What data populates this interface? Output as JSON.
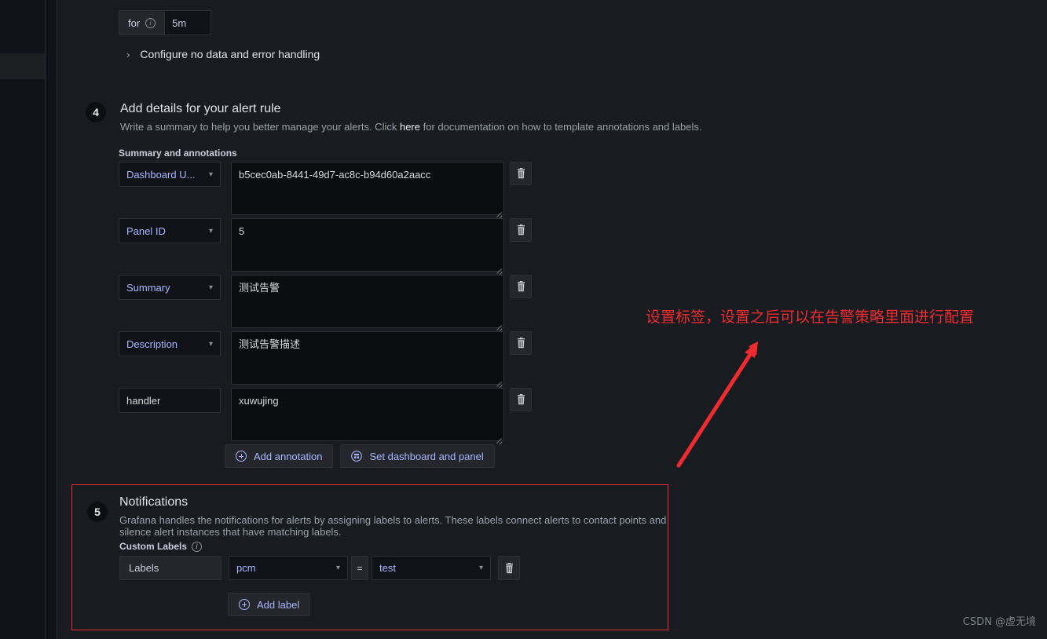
{
  "colors": {
    "accent_link": "#a7b6ff",
    "annotation_red": "#ee2b30",
    "panel_bg": "#181b1f",
    "input_bg": "#0b0c0e",
    "border": "#2e3036"
  },
  "condition": {
    "for_label": "for",
    "for_info_icon": "info-circle-icon",
    "for_value": "5m",
    "collapse_icon": "chevron-right-icon",
    "collapse_label": "Configure no data and error handling"
  },
  "step4": {
    "number": "4",
    "title": "Add details for your alert rule",
    "desc_before": "Write a summary to help you better manage your alerts. Click ",
    "desc_link": "here",
    "desc_after": " for documentation on how to template annotations and labels.",
    "section_label": "Summary and annotations",
    "annotations": [
      {
        "key": "Dashboard U...",
        "key_type": "select",
        "value": "b5cec0ab-8441-49d7-ac8c-b94d60a2aacc",
        "delete_icon": "trash-icon"
      },
      {
        "key": "Panel ID",
        "key_type": "select",
        "value": "5",
        "delete_icon": "trash-icon"
      },
      {
        "key": "Summary",
        "key_type": "select",
        "value": "测试告警",
        "delete_icon": "trash-icon"
      },
      {
        "key": "Description",
        "key_type": "select",
        "value": "测试告警描述",
        "delete_icon": "trash-icon"
      },
      {
        "key": "handler",
        "key_type": "text",
        "value": "xuwujing",
        "delete_icon": "trash-icon"
      }
    ],
    "add_annotation_label": "Add annotation",
    "add_annotation_icon": "circle-plus-icon",
    "set_dashboard_label": "Set dashboard and panel",
    "set_dashboard_icon": "dashboard-icon"
  },
  "step5": {
    "number": "5",
    "title": "Notifications",
    "description": "Grafana handles the notifications for alerts by assigning labels to alerts. These labels connect alerts to contact points and silence alert instances that have matching labels.",
    "custom_labels_label": "Custom Labels",
    "custom_labels_info_icon": "info-circle-icon",
    "label_row": {
      "prefix": "Labels",
      "key": "pcm",
      "operator": "=",
      "value": "test",
      "delete_icon": "trash-icon"
    },
    "add_label_label": "Add label",
    "add_label_icon": "circle-plus-icon"
  },
  "overlay": {
    "note_text": "设置标签，设置之后可以在告警策略里面进行配置",
    "arrow_icon": "arrow-up-right-icon"
  },
  "watermark": "CSDN @虚无境"
}
